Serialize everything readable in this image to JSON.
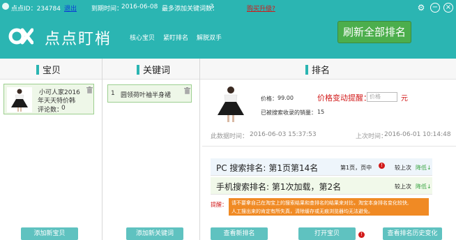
{
  "topbar": {
    "user_id": "点点ID：234784",
    "logout": "退出",
    "expire_label": "到期时间：",
    "expire_date": "2016-06-08",
    "max_keywords_label": "最多添加关键词数：",
    "max_keywords_value": "3",
    "buy_upgrade": "购买升级?"
  },
  "window_controls": [
    "gear-icon",
    "minimize-icon",
    "close-icon"
  ],
  "header": {
    "brand": "点点盯梢",
    "nav": [
      "核心宝贝",
      "紧盯排名",
      "解脱双手"
    ],
    "refresh_button": "刷新全部排名"
  },
  "baby_column": {
    "title": "宝贝",
    "item": {
      "name_line1": "小可人家2016",
      "name_line2": "年天天特价韩",
      "review_label": "评论数：",
      "review_count": "0"
    },
    "add_button": "添加新宝贝"
  },
  "keyword_column": {
    "title": "关键词",
    "item": {
      "index": "1",
      "keyword": "圆领荷叶袖半身裙"
    },
    "add_button": "添加新关键词"
  },
  "rank_column": {
    "title": "排名",
    "price_label": "价格：",
    "price_value": "99.00",
    "sales_label": "已被搜索收录的销量：",
    "sales_value": "15",
    "price_alert_label": "价格变动提醒：",
    "price_input_placeholder": "价格",
    "price_unit": "元",
    "data_time_label": "此数据时间：",
    "data_time_value": "2016-06-03 15:37:53",
    "last_time_label": "上次时间：",
    "last_time_value": "2016-06-01 10:14:48",
    "pc_label": "PC  搜索排名:",
    "pc_value": "第1页第14名",
    "pc_prev": "第1页，页中",
    "pc_compare": "较上次",
    "pc_trend": "降低",
    "mobile_label": "手机搜索排名:",
    "mobile_value": "第1次加载，第2名",
    "mobile_compare": "较上次",
    "mobile_trend": "降低",
    "reminder_label": "提醒：",
    "reminder_line1": "请不要拿自己在淘宝上的搜索结果和查排名的结果来对比，淘宝本身排名变化较快,",
    "reminder_line2": "人工搜出来的肯定有所失真，清除缓存或无痕浏览器均无法避免。",
    "view_new_button": "查看新排名",
    "open_baby_button": "打开宝贝",
    "history_button": "查看排名历史变化"
  },
  "colors": {
    "teal": "#2bb5b2",
    "green_button": "#4cae4c",
    "alert_red": "#d21a1a",
    "reminder_orange": "#f08a24"
  }
}
